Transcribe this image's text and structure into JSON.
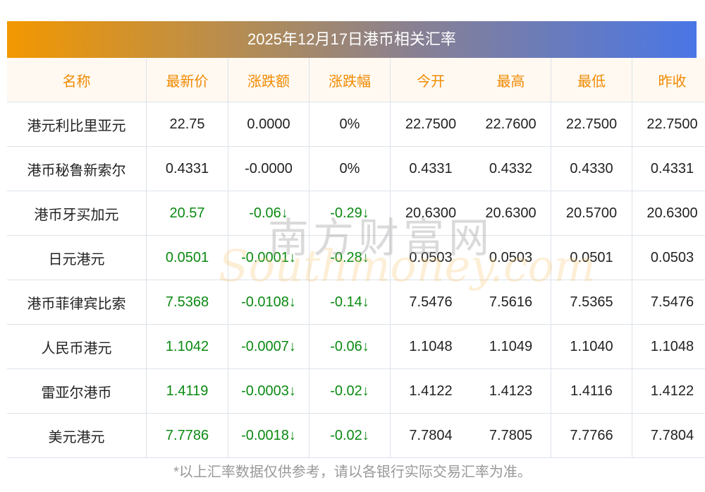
{
  "title": "2025年12月17日港币相关汇率",
  "headers": [
    "名称",
    "最新价",
    "涨跌额",
    "涨跌幅",
    "今开",
    "最高",
    "最低",
    "昨收"
  ],
  "rows": [
    [
      "港元利比里亚元",
      "22.75",
      "0.0000",
      "0%",
      "22.7500",
      "22.7600",
      "22.7500",
      "22.7500"
    ],
    [
      "港币秘鲁新索尔",
      "0.4331",
      "-0.0000",
      "0%",
      "0.4331",
      "0.4332",
      "0.4330",
      "0.4331"
    ],
    [
      "港币牙买加元",
      "20.57",
      "-0.06↓",
      "-0.29↓",
      "20.6300",
      "20.6300",
      "20.5700",
      "20.6300"
    ],
    [
      "日元港元",
      "0.0501",
      "-0.0001↓",
      "-0.28↓",
      "0.0503",
      "0.0503",
      "0.0501",
      "0.0503"
    ],
    [
      "港币菲律宾比索",
      "7.5368",
      "-0.0108↓",
      "-0.14↓",
      "7.5476",
      "7.5616",
      "7.5365",
      "7.5476"
    ],
    [
      "人民币港元",
      "1.1042",
      "-0.0007↓",
      "-0.06↓",
      "1.1048",
      "1.1049",
      "1.1040",
      "1.1048"
    ],
    [
      "雷亚尔港币",
      "1.4119",
      "-0.0003↓",
      "-0.02↓",
      "1.4122",
      "1.4123",
      "1.4116",
      "1.4122"
    ],
    [
      "美元港元",
      "7.7786",
      "-0.0018↓",
      "-0.02↓",
      "7.7804",
      "7.7805",
      "7.7766",
      "7.7804"
    ]
  ],
  "green_rows": [
    2,
    3,
    4,
    5,
    6,
    7
  ],
  "watermark": {
    "cn": "南方财富网",
    "en": "Southmoney.com"
  },
  "footer": "*以上汇率数据仅供参考，请以各银行实际交易汇率为准。"
}
